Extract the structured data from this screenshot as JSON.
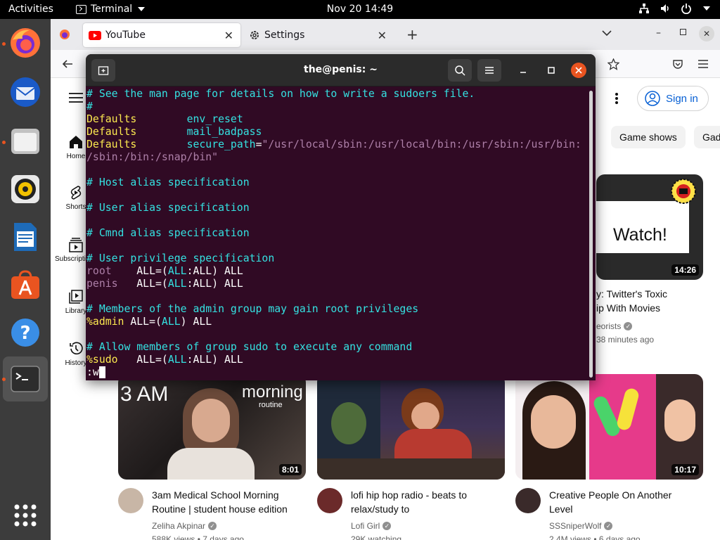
{
  "topbar": {
    "activities": "Activities",
    "app_name": "Terminal",
    "clock": "Nov 20  14:49"
  },
  "dock": {
    "items": [
      "firefox-icon",
      "thunderbird-icon",
      "files-icon",
      "rhythmbox-icon",
      "writer-icon",
      "app-center-icon",
      "help-icon",
      "terminal-icon"
    ],
    "show_apps": "grid-icon",
    "accent": "#e95420"
  },
  "firefox": {
    "tabs": [
      {
        "label": "YouTube",
        "active": true
      },
      {
        "label": "Settings",
        "active": false
      }
    ]
  },
  "youtube": {
    "sidebar": [
      {
        "label": "Home"
      },
      {
        "label": "Shorts"
      },
      {
        "label": "Subscriptions"
      },
      {
        "label": "Library"
      },
      {
        "label": "History"
      }
    ],
    "sign_in": "Sign in",
    "chips": [
      "Game shows",
      "Gad"
    ],
    "top_video": {
      "thumb_text": "Watch!",
      "duration": "14:26",
      "title_line1": "y: Twitter's Toxic",
      "title_line2": "ip With Movies",
      "channel": "eorists",
      "meta": "38 minutes ago"
    },
    "videos": [
      {
        "thumb_text": "3 AM",
        "thumb_text2": "morning",
        "thumb_text3": "routine",
        "duration": "8:01",
        "title_line1": "3am Medical School Morning",
        "title_line2": "Routine | student house edition",
        "channel": "Zeliha Akpinar",
        "meta": "588K views • 7 days ago"
      },
      {
        "duration": "",
        "title_line1": "lofi hip hop radio - beats to",
        "title_line2": "relax/study to",
        "channel": "Lofi Girl",
        "meta": "29K watching"
      },
      {
        "duration": "10:17",
        "title_line1": "Creative People On Another",
        "title_line2": "Level",
        "channel": "SSSniperWolf",
        "meta": "2.4M views • 6 days ago"
      }
    ]
  },
  "terminal": {
    "title": "the@penis: ~",
    "lines": {
      "l1": "# See the man page for details on how to write a sudoers file.",
      "l2": "#",
      "l3_kw": "Defaults",
      "l3_val": "env_reset",
      "l4_kw": "Defaults",
      "l4_val": "mail_badpass",
      "l5_kw": "Defaults",
      "l5_val": "secure_path",
      "l5_str": "\"/usr/local/sbin:/usr/local/bin:/usr/sbin:/usr/bin:",
      "l6_str": "/sbin:/bin:/snap/bin\"",
      "l8": "# Host alias specification",
      "l10": "# User alias specification",
      "l12": "# Cmnd alias specification",
      "l14": "# User privilege specification",
      "l15_user": "root",
      "l16_user": "penis",
      "l18": "# Members of the admin group may gain root privileges",
      "l19_user": "%admin",
      "l21": "# Allow members of group sudo to execute any command",
      "l22_user": "%sudo",
      "cmd": ":w"
    }
  }
}
